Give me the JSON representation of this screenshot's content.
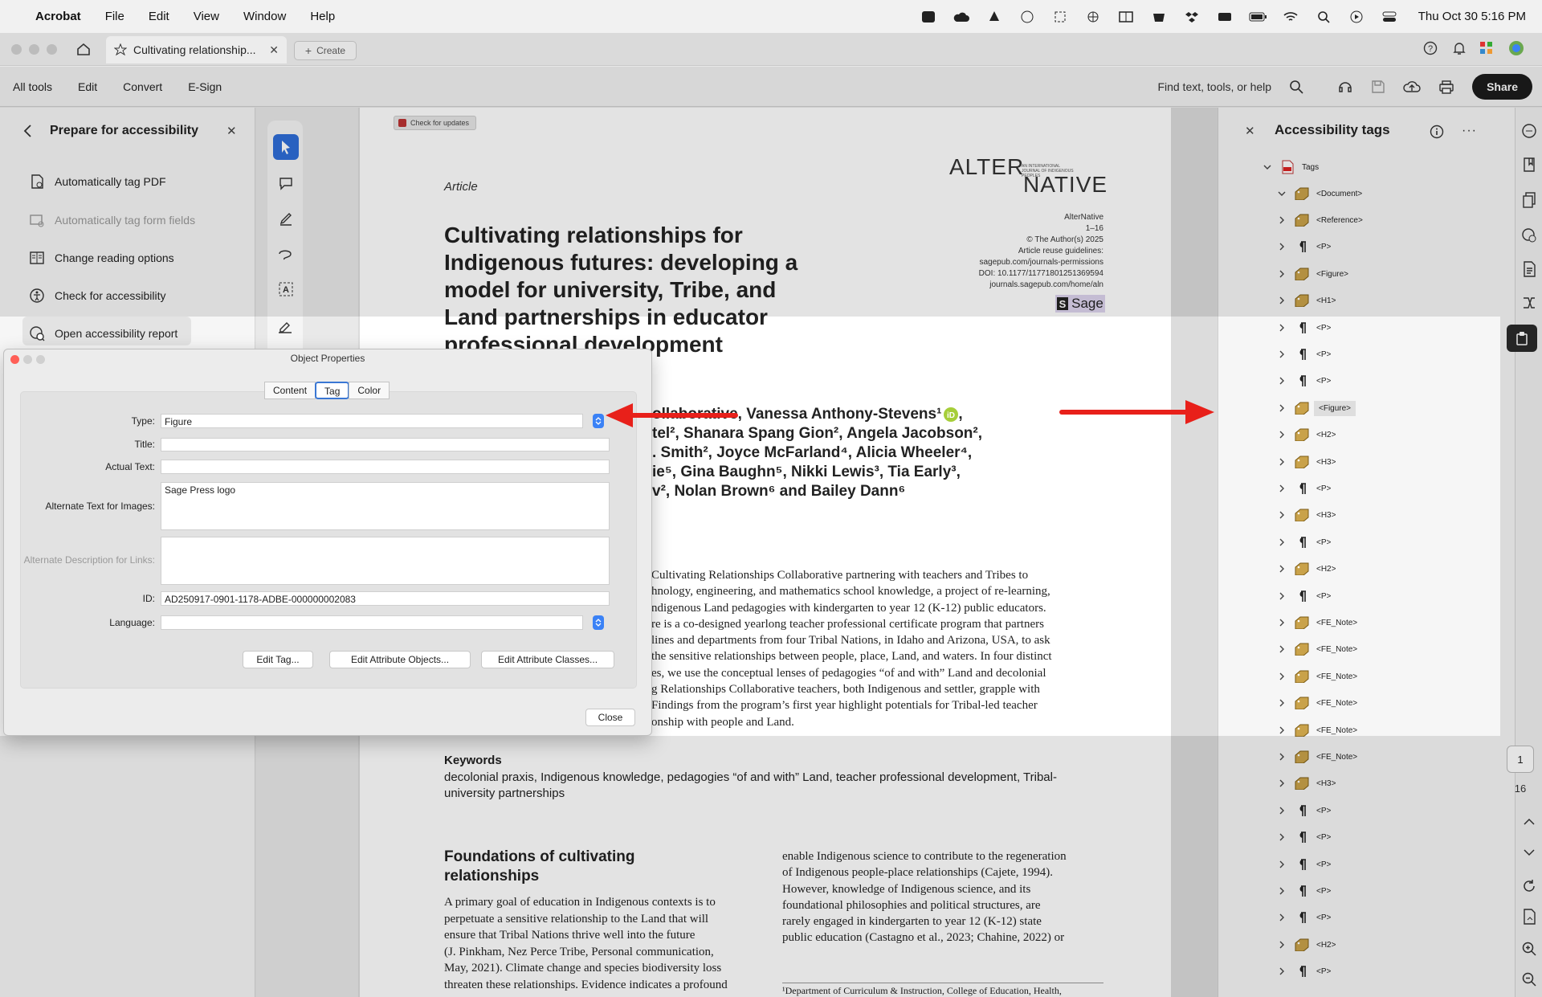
{
  "menubar": {
    "app": "Acrobat",
    "items": [
      "File",
      "Edit",
      "View",
      "Window",
      "Help"
    ],
    "clock": "Thu Oct 30  5:16 PM"
  },
  "tabs": {
    "active_title": "Cultivating relationship...",
    "create_label": "Create"
  },
  "toolbar": {
    "items": [
      "All tools",
      "Edit",
      "Convert",
      "E-Sign"
    ],
    "search_placeholder": "Find text, tools, or help",
    "share_label": "Share"
  },
  "left_panel": {
    "title": "Prepare for accessibility",
    "items": [
      {
        "label": "Automatically tag PDF",
        "enabled": true
      },
      {
        "label": "Automatically tag form fields",
        "enabled": false
      },
      {
        "label": "Change reading options",
        "enabled": true
      },
      {
        "label": "Check for accessibility",
        "enabled": true
      },
      {
        "label": "Open accessibility report",
        "enabled": true
      }
    ]
  },
  "document": {
    "update_badge": "Check for updates",
    "section_label": "Article",
    "journal_logo_top": "ALTER",
    "journal_logo_bottom": "NATIVE",
    "journal_tagline": "AN INTERNATIONAL JOURNAL OF INDIGENOUS PEOPLES",
    "meta": [
      "AlterNative",
      "1–16",
      "© The Author(s) 2025",
      "Article reuse guidelines:",
      "sagepub.com/journals-permissions",
      "DOI: 10.1177/11771801251369594",
      "journals.sagepub.com/home/aln"
    ],
    "publisher_logo": "Sage",
    "title_lines": [
      "Cultivating relationships for",
      "Indigenous futures: developing a",
      "model for university, Tribe, and",
      "Land partnerships in educator",
      "professional development"
    ],
    "author_lines": [
      "ollaborative, Vanessa Anthony-Stevens¹",
      "tel², Shanara Spang Gion², Angela Jacobson²,",
      ". Smith², Joyce McFarland⁴, Alicia Wheeler⁴,",
      "ie⁵, Gina Baughn⁵, Nikki Lewis³, Tia Early³,",
      "v², Nolan Brown⁶ and Bailey Dann⁶"
    ],
    "abstract_lines": [
      "Cultivating Relationships Collaborative partnering with teachers and Tribes to",
      "hnology, engineering, and mathematics school knowledge, a project of re-learning,",
      "ndigenous Land pedagogies with kindergarten to year 12 (K-12) public educators.",
      "re is a co-designed yearlong teacher professional certificate program that partners",
      "lines and departments from four Tribal Nations, in Idaho and Arizona, USA, to ask",
      "the sensitive relationships between people, place, Land, and waters. In four distinct",
      "es, we use the conceptual lenses of pedagogies “of and with” Land and decolonial",
      "g Relationships Collaborative teachers, both Indigenous and settler, grapple with",
      "Findings from the program’s first year highlight potentials for Tribal-led teacher",
      "onship with people and Land."
    ],
    "keywords_heading": "Keywords",
    "keywords_lines": [
      "decolonial praxis, Indigenous knowledge, pedagogies “of and with” Land, teacher professional development, Tribal-",
      "university partnerships"
    ],
    "section_heading_lines": [
      "Foundations of cultivating",
      "relationships"
    ],
    "col1_lines": [
      "A primary goal of education in Indigenous contexts is to",
      "perpetuate a sensitive relationship to the Land that will",
      "ensure that Tribal Nations thrive well into the future",
      "(J. Pinkham, Nez Perce Tribe, Personal communication,",
      "May, 2021). Climate change and species biodiversity loss",
      "threaten these relationships. Evidence indicates a profound"
    ],
    "col2_lines": [
      "enable Indigenous science to contribute to the regeneration",
      "of Indigenous people-place relationships (Cajete, 1994).",
      "However, knowledge of Indigenous science, and its",
      "foundational philosophies and political structures, are",
      "rarely engaged in kindergarten to year 12 (K-12) state",
      "public education (Castagno et al., 2023; Chahine, 2022) or"
    ],
    "footnote": "¹Department of Curriculum & Instruction, College of Education, Health,"
  },
  "dialog": {
    "title": "Object Properties",
    "tabs": [
      "Content",
      "Tag",
      "Color"
    ],
    "active_tab": "Tag",
    "fields": {
      "type_label": "Type:",
      "type_value": "Figure",
      "title_label": "Title:",
      "title_value": "",
      "actual_label": "Actual Text:",
      "actual_value": "",
      "alt_label": "Alternate Text for Images:",
      "alt_value": "Sage Press logo",
      "altdesc_label": "Alternate Description for Links:",
      "altdesc_value": "",
      "id_label": "ID:",
      "id_value": "AD250917-0901-1178-ADBE-000000002083",
      "lang_label": "Language:",
      "lang_value": ""
    },
    "buttons": {
      "edit_tag": "Edit Tag...",
      "edit_attr_objects": "Edit Attribute Objects...",
      "edit_attr_classes": "Edit Attribute Classes...",
      "close": "Close"
    }
  },
  "right_panel": {
    "title": "Accessibility tags",
    "root": "Tags",
    "document": "<Document>",
    "tags": [
      {
        "label": "<Reference>",
        "kind": "struct"
      },
      {
        "label": "<P>",
        "kind": "para"
      },
      {
        "label": "<Figure>",
        "kind": "struct"
      },
      {
        "label": "<H1>",
        "kind": "struct"
      },
      {
        "label": "<P>",
        "kind": "para"
      },
      {
        "label": "<P>",
        "kind": "para"
      },
      {
        "label": "<P>",
        "kind": "para"
      },
      {
        "label": "<Figure>",
        "kind": "struct",
        "selected": true
      },
      {
        "label": "<H2>",
        "kind": "struct"
      },
      {
        "label": "<H3>",
        "kind": "struct"
      },
      {
        "label": "<P>",
        "kind": "para"
      },
      {
        "label": "<H3>",
        "kind": "struct"
      },
      {
        "label": "<P>",
        "kind": "para"
      },
      {
        "label": "<H2>",
        "kind": "struct"
      },
      {
        "label": "<P>",
        "kind": "para"
      },
      {
        "label": "<FE_Note>",
        "kind": "struct"
      },
      {
        "label": "<FE_Note>",
        "kind": "struct"
      },
      {
        "label": "<FE_Note>",
        "kind": "struct"
      },
      {
        "label": "<FE_Note>",
        "kind": "struct"
      },
      {
        "label": "<FE_Note>",
        "kind": "struct"
      },
      {
        "label": "<FE_Note>",
        "kind": "struct"
      },
      {
        "label": "<H3>",
        "kind": "struct"
      },
      {
        "label": "<P>",
        "kind": "para"
      },
      {
        "label": "<P>",
        "kind": "para"
      },
      {
        "label": "<P>",
        "kind": "para"
      },
      {
        "label": "<P>",
        "kind": "para"
      },
      {
        "label": "<P>",
        "kind": "para"
      },
      {
        "label": "<H2>",
        "kind": "struct"
      },
      {
        "label": "<P>",
        "kind": "para"
      }
    ]
  },
  "page_nav": {
    "current": "1",
    "total": "16"
  },
  "colors": {
    "accent": "#3a77d4",
    "arrow": "#e8201a",
    "tag_icon": "#c9a24a"
  }
}
